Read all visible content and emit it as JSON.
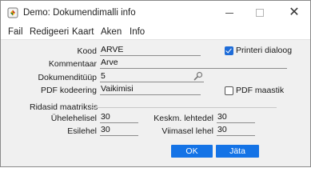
{
  "window": {
    "title": "Demo: Dokumendimalli info",
    "controls": {
      "minimize": "—",
      "maximize": "☐",
      "close": "✕"
    }
  },
  "menu": [
    "Fail",
    "Redigeeri",
    "Kaart",
    "Aken",
    "Info"
  ],
  "form": {
    "kood": {
      "label": "Kood",
      "value": "ARVE"
    },
    "kommentaar": {
      "label": "Kommentaar",
      "value": "Arve"
    },
    "dokumendituup": {
      "label": "Dokumenditüüp",
      "value": "5"
    },
    "pdf_kodeering": {
      "label": "PDF kodeering",
      "value": "Vaikimisi"
    },
    "printeri_dialoog": {
      "label": "Printeri dialoog",
      "checked": true
    },
    "pdf_maastik": {
      "label": "PDF maastik",
      "checked": false
    }
  },
  "section": {
    "title": "Ridasid maatriksis",
    "uhelehelisel": {
      "label": "Ühelehelisel",
      "value": "30"
    },
    "esilehel": {
      "label": "Esilehel",
      "value": "30"
    },
    "keskm_lehtedel": {
      "label": "Keskm. lehtedel",
      "value": "30"
    },
    "viimasel_lehel": {
      "label": "Viimasel lehel",
      "value": "30"
    }
  },
  "buttons": {
    "ok": "OK",
    "cancel": "Jäta"
  },
  "colors": {
    "accent": "#1473e6",
    "background": "#f0f0f0",
    "titlebar": "#ffffff"
  }
}
